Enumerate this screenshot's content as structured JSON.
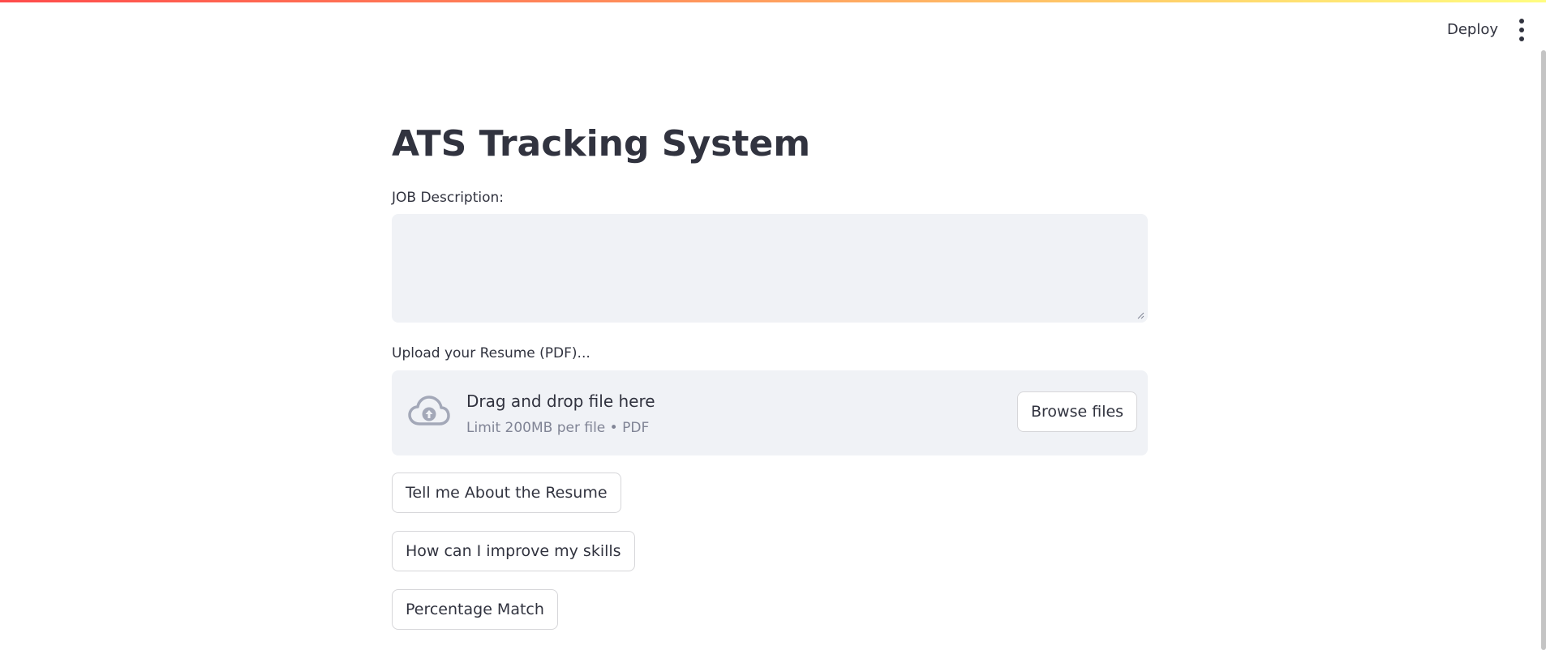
{
  "header": {
    "deploy_label": "Deploy",
    "menu_icon": "vertical-ellipsis-icon"
  },
  "main": {
    "title": "ATS Tracking System",
    "job_description": {
      "label": "JOB Description:",
      "value": ""
    },
    "resume_upload": {
      "label": "Upload your Resume (PDF)...",
      "drop_title": "Drag and drop file here",
      "drop_subtitle": "Limit 200MB per file • PDF",
      "browse_label": "Browse files",
      "icon": "cloud-upload-icon"
    },
    "actions": [
      {
        "label": "Tell me About the Resume"
      },
      {
        "label": "How can I improve my skills"
      },
      {
        "label": "Percentage Match"
      }
    ]
  },
  "colors": {
    "text": "#31333f",
    "muted": "#808495",
    "input_bg": "#f0f2f6",
    "border": "#d6d6d9",
    "accent_start": "#ff4b4b",
    "accent_end": "#fffd80"
  }
}
